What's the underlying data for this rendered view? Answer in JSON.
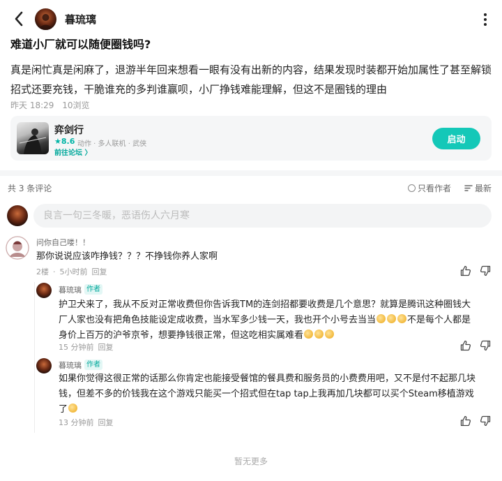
{
  "header": {
    "author_name": "暮琉璃"
  },
  "post": {
    "title": "难道小厂就可以随便圈钱吗?",
    "body": "真是闲忙真是闲麻了，退游半年回来想看一眼有没有出新的内容，结果发现时装都开始加属性了甚至解锁招式还要充钱，干脆谁充的多判谁赢呗，小厂挣钱难能理解，但这不是圈钱的理由",
    "time": "昨天 18:29",
    "views": "10浏览"
  },
  "game": {
    "name": "弈剑行",
    "rating": "★8.6",
    "tags": "动作 · 多人联机 · 武侠",
    "forum_link": "前往论坛 〉",
    "launch_label": "启动"
  },
  "comments_bar": {
    "count": "共 3 条评论",
    "only_author": "只看作者",
    "sort_latest": "最新"
  },
  "input": {
    "placeholder": "良言一句三冬暖，恶语伤人六月寒"
  },
  "comments": [
    {
      "name": "问你自己喽！！",
      "text": "那你说说应该咋挣钱？？？不挣钱你养人家啊",
      "floor": "2楼",
      "time": "5小时前",
      "reply_label": "回复"
    }
  ],
  "replies": [
    {
      "name": "暮琉璃",
      "tag": "作者",
      "text_line1": "护卫犬来了，我从不反对正常收费但你告诉我TM的连剑招都要收费是几个意思？就算是腾讯这种圈钱大",
      "text_line2": "厂人家也没有把角色技能设定成收费，当水军多少钱一天，我也开个小号去当当",
      "text_line2_after": "不是每个人都是",
      "text_line3": "身价上百万的沪爷京爷，想要挣钱很正常，但这吃相实属难看",
      "time": "15 分钟前",
      "reply_label": "回复"
    },
    {
      "name": "暮琉璃",
      "tag": "作者",
      "text_line1": "如果你觉得这很正常的话那么你肯定也能接受餐馆的餐具费和服务员的小费费用吧，又不是付不起那几块",
      "text_line2": "钱，但差不多的价钱我在这个游戏只能买一个招式但在tap tap上我再加几块都可以买个Steam移植游戏",
      "text_line3": "了",
      "time": "13 分钟前",
      "reply_label": "回复"
    }
  ],
  "footer": {
    "no_more": "暂无更多"
  },
  "colors": {
    "accent": "#14c8b8",
    "author_tag": "#00a89b"
  }
}
